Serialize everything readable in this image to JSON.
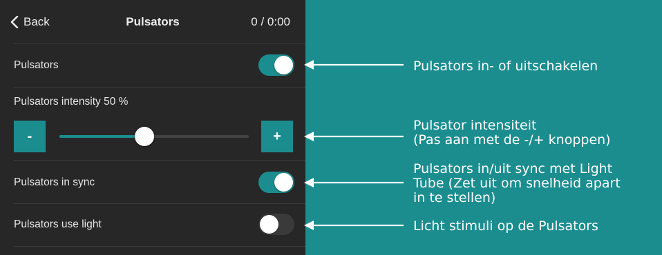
{
  "header": {
    "back_label": "Back",
    "title": "Pulsators",
    "counter": "0 / 0:00"
  },
  "settings": {
    "pulsators": {
      "label": "Pulsators",
      "enabled": true
    },
    "intensity": {
      "label": "Pulsators intensity 50 %",
      "value": 0.5,
      "minus_label": "-",
      "plus_label": "+"
    },
    "sync": {
      "label": "Pulsators in sync",
      "enabled": true
    },
    "use_light": {
      "label": "Pulsators use light",
      "enabled": false
    }
  },
  "annotations": {
    "pulsators": "Pulsators in- of uitschakelen",
    "intensity_line1": "Pulsator intensiteit",
    "intensity_line2": "(Pas aan met de -/+ knoppen)",
    "sync_line1": "Pulsators in/uit sync met Light",
    "sync_line2": "Tube (Zet uit om snelheid apart",
    "sync_line3": "in te stellen)",
    "use_light": "Licht stimuli op de Pulsators"
  },
  "colors": {
    "accent": "#1b8d8f",
    "panel": "#272728",
    "toggle_off": "#3a3a3b"
  },
  "icons": {
    "back": "chevron-left-icon"
  }
}
